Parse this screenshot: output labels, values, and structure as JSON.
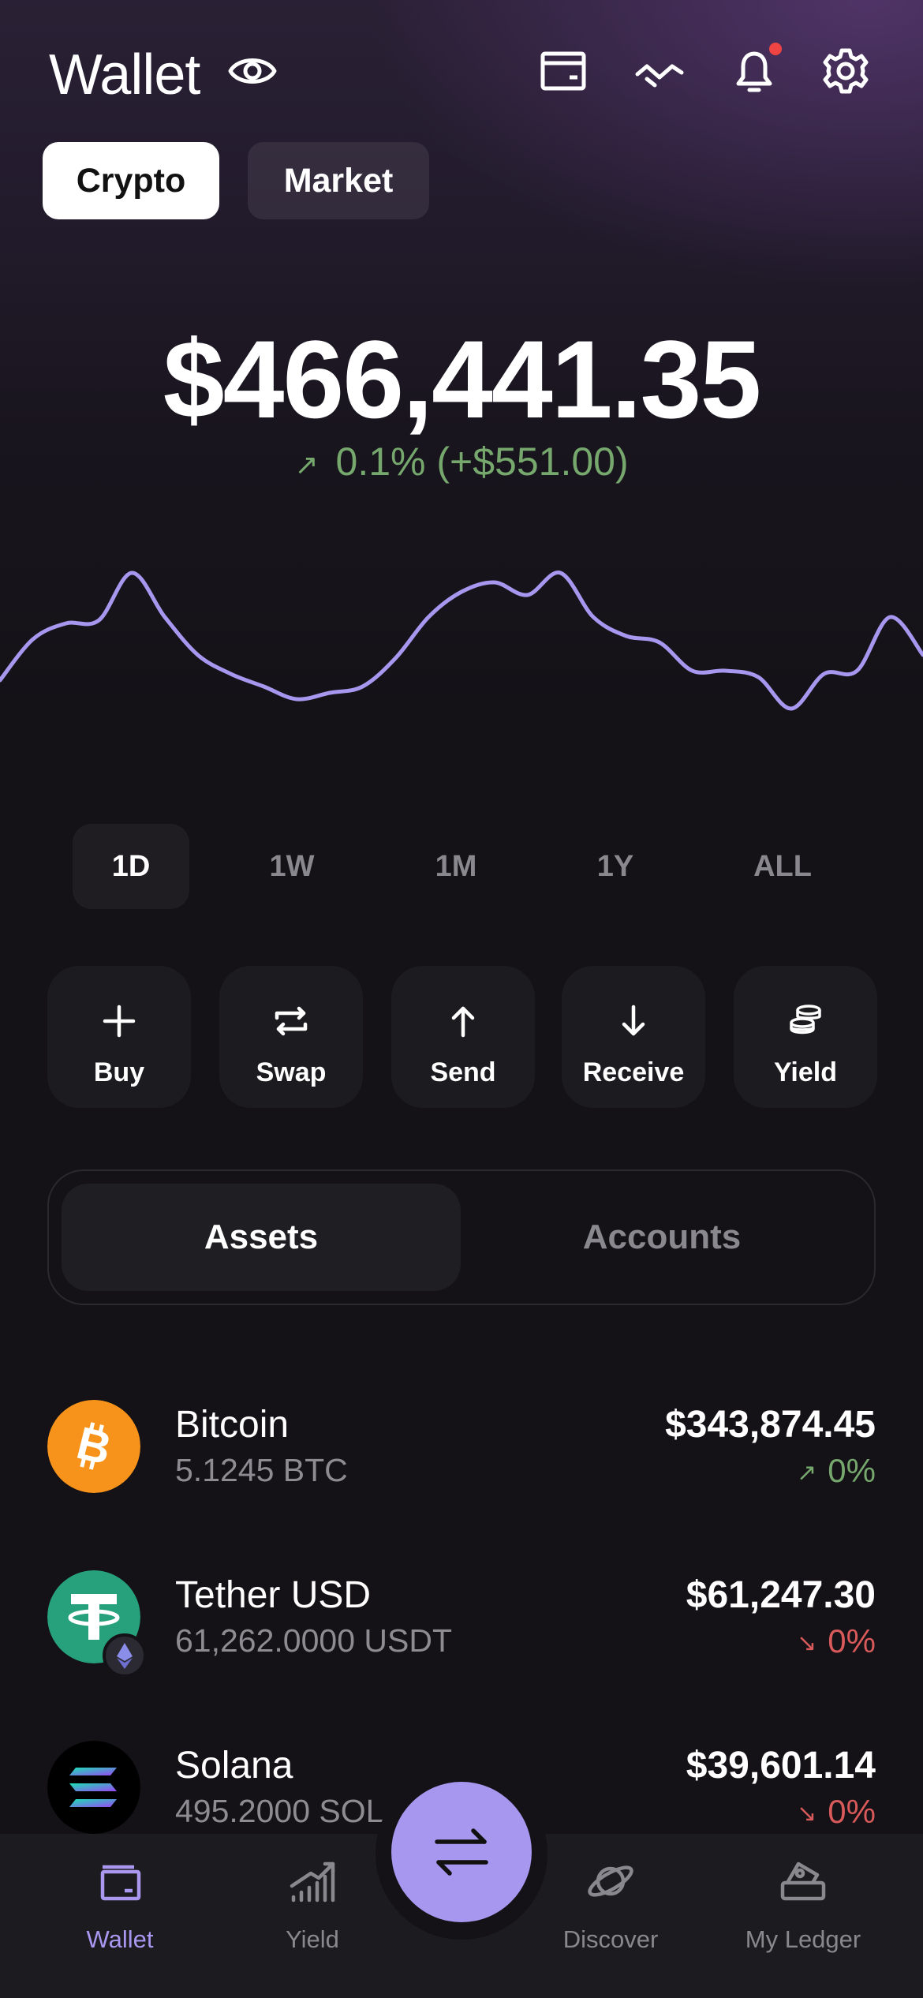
{
  "header": {
    "title": "Wallet",
    "icons": [
      "eye-icon",
      "card-icon",
      "wave-icon",
      "bell-icon",
      "gear-icon"
    ]
  },
  "tabs": [
    {
      "label": "Crypto",
      "active": true
    },
    {
      "label": "Market",
      "active": false
    }
  ],
  "portfolio": {
    "balance": "$466,441.35",
    "change_arrow": "↗",
    "change": "0.1% (+$551.00)",
    "change_color": "#76a86e"
  },
  "chart_data": {
    "type": "line",
    "color": "#a797ef",
    "values": [
      42,
      55,
      60,
      61,
      76,
      62,
      50,
      44,
      40,
      36,
      38,
      40,
      49,
      62,
      70,
      73,
      69,
      76,
      62,
      56,
      54,
      45,
      45,
      43,
      33,
      44,
      45,
      62,
      50
    ],
    "ylim": [
      25,
      85
    ],
    "grid": false
  },
  "ranges": [
    {
      "label": "1D",
      "active": true
    },
    {
      "label": "1W",
      "active": false
    },
    {
      "label": "1M",
      "active": false
    },
    {
      "label": "1Y",
      "active": false
    },
    {
      "label": "ALL",
      "active": false
    }
  ],
  "actions": [
    {
      "label": "Buy",
      "icon": "plus-icon"
    },
    {
      "label": "Swap",
      "icon": "swap-icon"
    },
    {
      "label": "Send",
      "icon": "arrow-up-icon"
    },
    {
      "label": "Receive",
      "icon": "arrow-down-icon"
    },
    {
      "label": "Yield",
      "icon": "coins-icon"
    }
  ],
  "segment": {
    "assets": "Assets",
    "accounts": "Accounts",
    "active": "assets"
  },
  "assets": [
    {
      "name": "Bitcoin",
      "qty": "5.1245 BTC",
      "value": "$343,874.45",
      "arrow": "↗",
      "pct": "0%",
      "trend": "up",
      "color": "#f7931a"
    },
    {
      "name": "Tether USD",
      "qty": "61,262.0000 USDT",
      "value": "$61,247.30",
      "arrow": "↘",
      "pct": "0%",
      "trend": "down",
      "color": "#26a17b"
    },
    {
      "name": "Solana",
      "qty": "495.2000 SOL",
      "value": "$39,601.14",
      "arrow": "↘",
      "pct": "0%",
      "trend": "down",
      "color": "#000000"
    }
  ],
  "nav": [
    {
      "label": "Wallet",
      "icon": "wallet-icon",
      "active": true
    },
    {
      "label": "Yield",
      "icon": "chart-icon",
      "active": false
    },
    {
      "label": "Discover",
      "icon": "planet-icon",
      "active": false
    },
    {
      "label": "My Ledger",
      "icon": "ledger-device-icon",
      "active": false
    }
  ],
  "fab": {
    "icon": "transfer-arrows-icon"
  },
  "colors": {
    "accent": "#a797ef",
    "up": "#76a86e",
    "down": "#d85a5a"
  }
}
